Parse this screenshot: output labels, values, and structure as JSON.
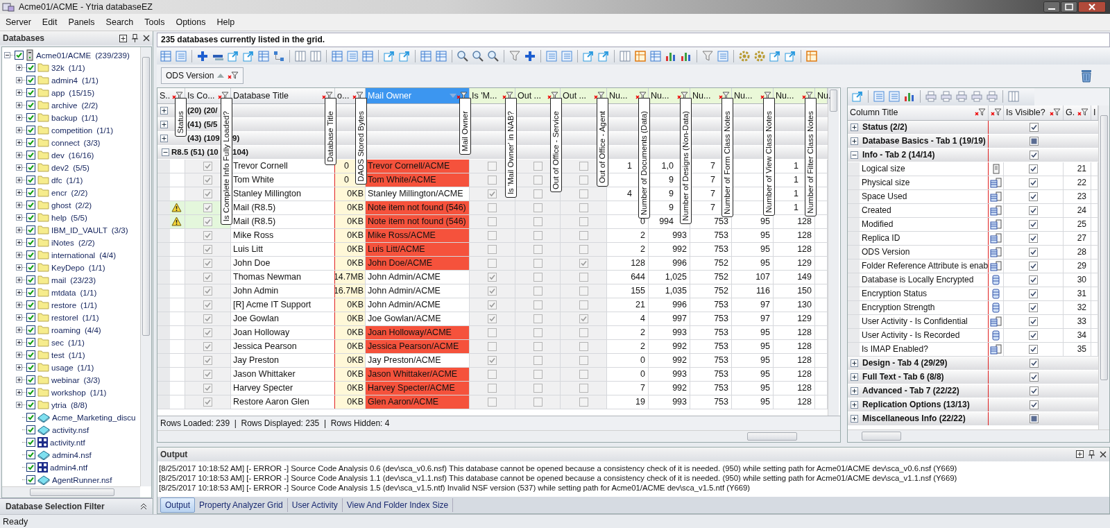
{
  "window": {
    "title": "Acme01/ACME - Ytria databaseEZ"
  },
  "menu": [
    "Server",
    "Edit",
    "Panels",
    "Search",
    "Tools",
    "Options",
    "Help"
  ],
  "databases_panel": {
    "title": "Databases",
    "tree": [
      {
        "kind": "server",
        "name": "Acme01/ACME",
        "count": "(239/239)",
        "checked": true,
        "expanded": true,
        "children": [
          {
            "kind": "folder",
            "name": "32k",
            "count": "(1/1)",
            "checked": true,
            "expanded": false
          },
          {
            "kind": "folder",
            "name": "admin4",
            "count": "(1/1)",
            "checked": true,
            "expanded": false
          },
          {
            "kind": "folder",
            "name": "app",
            "count": "(15/15)",
            "checked": true,
            "expanded": false
          },
          {
            "kind": "folder",
            "name": "archive",
            "count": "(2/2)",
            "checked": true,
            "expanded": false
          },
          {
            "kind": "folder",
            "name": "backup",
            "count": "(1/1)",
            "checked": true,
            "expanded": false
          },
          {
            "kind": "folder",
            "name": "competition",
            "count": "(1/1)",
            "checked": true,
            "expanded": false
          },
          {
            "kind": "folder",
            "name": "connect",
            "count": "(3/3)",
            "checked": true,
            "expanded": false
          },
          {
            "kind": "folder",
            "name": "dev",
            "count": "(16/16)",
            "checked": true,
            "expanded": false
          },
          {
            "kind": "folder",
            "name": "dev2",
            "count": "(5/5)",
            "checked": true,
            "expanded": false
          },
          {
            "kind": "folder",
            "name": "dfc",
            "count": "(1/1)",
            "checked": true,
            "expanded": false
          },
          {
            "kind": "folder",
            "name": "encr",
            "count": "(2/2)",
            "checked": true,
            "expanded": false
          },
          {
            "kind": "folder",
            "name": "ghost",
            "count": "(2/2)",
            "checked": true,
            "expanded": false
          },
          {
            "kind": "folder",
            "name": "help",
            "count": "(5/5)",
            "checked": true,
            "expanded": false
          },
          {
            "kind": "folder",
            "name": "IBM_ID_VAULT",
            "count": "(3/3)",
            "checked": true,
            "expanded": false
          },
          {
            "kind": "folder",
            "name": "iNotes",
            "count": "(2/2)",
            "checked": true,
            "expanded": false
          },
          {
            "kind": "folder",
            "name": "international",
            "count": "(4/4)",
            "checked": true,
            "expanded": false
          },
          {
            "kind": "folder",
            "name": "KeyDepo",
            "count": "(1/1)",
            "checked": true,
            "expanded": false
          },
          {
            "kind": "folder",
            "name": "mail",
            "count": "(23/23)",
            "checked": true,
            "expanded": false
          },
          {
            "kind": "folder",
            "name": "mtdata",
            "count": "(1/1)",
            "checked": true,
            "expanded": false
          },
          {
            "kind": "folder",
            "name": "restore",
            "count": "(1/1)",
            "checked": true,
            "expanded": false
          },
          {
            "kind": "folder",
            "name": "restorel",
            "count": "(1/1)",
            "checked": true,
            "expanded": false
          },
          {
            "kind": "folder",
            "name": "roaming",
            "count": "(4/4)",
            "checked": true,
            "expanded": false
          },
          {
            "kind": "folder",
            "name": "sec",
            "count": "(1/1)",
            "checked": true,
            "expanded": false
          },
          {
            "kind": "folder",
            "name": "test",
            "count": "(1/1)",
            "checked": true,
            "expanded": false
          },
          {
            "kind": "folder",
            "name": "usage",
            "count": "(1/1)",
            "checked": true,
            "expanded": false
          },
          {
            "kind": "folder",
            "name": "webinar",
            "count": "(3/3)",
            "checked": true,
            "expanded": false
          },
          {
            "kind": "folder",
            "name": "workshop",
            "count": "(1/1)",
            "checked": true,
            "expanded": false
          },
          {
            "kind": "folder",
            "name": "ytria",
            "count": "(8/8)",
            "checked": true,
            "expanded": false
          },
          {
            "kind": "nsf",
            "name": "Acme_Marketing_discu",
            "checked": true
          },
          {
            "kind": "nsf",
            "name": "activity.nsf",
            "checked": true
          },
          {
            "kind": "ntf",
            "name": "activity.ntf",
            "checked": true
          },
          {
            "kind": "nsf",
            "name": "admin4.nsf",
            "checked": true
          },
          {
            "kind": "ntf",
            "name": "admin4.ntf",
            "checked": true
          },
          {
            "kind": "nsf",
            "name": "AgentRunner.nsf",
            "checked": true
          }
        ]
      }
    ],
    "footer": "Database Selection Filter"
  },
  "info": "235 databases currently listed in the grid.",
  "group_by": [
    {
      "label": "ODS Version",
      "sorted_ascending": true
    }
  ],
  "grid": {
    "columns": [
      {
        "kind": "status",
        "title": "S..",
        "flag": "Status",
        "selected": false
      },
      {
        "kind": "complete",
        "title": "Is Co...",
        "flag": "Is Complete Info Fully Loaded?",
        "selected": false
      },
      {
        "kind": "title",
        "title": "Database Title",
        "flag": "Database Title",
        "selected": false
      },
      {
        "kind": "size",
        "title": "o...",
        "flag": "DAOS Stored Bytes",
        "selected": false
      },
      {
        "kind": "owner",
        "title": "Mail Owner",
        "flag": "Mail Owner",
        "selected": true,
        "sorted": true
      },
      {
        "kind": "check",
        "title": "Is 'M...",
        "flag": "Is 'Mail Owner' in NAB?",
        "selected": false,
        "color": "#eaf8d8"
      },
      {
        "kind": "check",
        "title": "Out ...",
        "flag": "Out of Office - Service",
        "selected": false,
        "color": "#eaf8d8"
      },
      {
        "kind": "check",
        "title": "Out ...",
        "flag": "Out of Office - Agent",
        "selected": false,
        "color": "#eaf8d8"
      },
      {
        "kind": "number",
        "title": "Nu...",
        "flag": "Number of Documents (Data)",
        "selected": false,
        "color": "#eaf8d8"
      },
      {
        "kind": "number",
        "title": "Nu...",
        "flag": "Number of Designs (Non-Data)",
        "selected": false,
        "color": "#eaf8d8"
      },
      {
        "kind": "number",
        "title": "Nu...",
        "flag": "Number of Form Class Notes",
        "selected": false,
        "color": "#eaf8d8"
      },
      {
        "kind": "number",
        "title": "Nu...",
        "flag": "Number of View Class Notes",
        "selected": false,
        "color": "#eaf8d8"
      },
      {
        "kind": "number",
        "title": "Nu...",
        "flag": "Number of Filter Class Notes",
        "selected": false,
        "color": "#eaf8d8"
      },
      {
        "kind": "number",
        "title": "Nu.",
        "selected": false,
        "color": "#eaf8d8"
      }
    ],
    "groups": [
      {
        "label": "(20) (20/",
        "expanded": false
      },
      {
        "label": "(41) (5/5",
        "expanded": false
      },
      {
        "label": "(43) (109",
        "tail": "9)",
        "expanded": false
      },
      {
        "label": "R8.5 (51) (10",
        "tail": "104)",
        "expanded": true,
        "rows": [
          {
            "warning": false,
            "complete": true,
            "title": "Trevor Cornell",
            "daos": "0",
            "owner": "Trevor Cornell/ACME",
            "owner_error": true,
            "in_nab": false,
            "ooo_service": false,
            "ooo_agent": false,
            "docs": "1",
            "designs": "1,0",
            "forms": "7",
            "filters": "1"
          },
          {
            "warning": false,
            "complete": true,
            "title": "Tom White",
            "daos": "0",
            "owner": "Tom White/ACME",
            "owner_error": true,
            "in_nab": false,
            "ooo_service": false,
            "ooo_agent": false,
            "designs": "9",
            "forms": "7",
            "filters": "1"
          },
          {
            "warning": false,
            "complete": true,
            "title": "Stanley Millington",
            "daos": "0KB",
            "owner": "Stanley Millington/ACME",
            "owner_error": false,
            "in_nab": true,
            "ooo_service": false,
            "ooo_agent": false,
            "docs": "4",
            "designs": "9",
            "forms": "7",
            "filters": "1"
          },
          {
            "warning": true,
            "complete": true,
            "title": "Mail (R8.5)",
            "daos": "0KB",
            "owner": "Note item not found (546)",
            "owner_error": true,
            "in_nab": false,
            "ooo_service": false,
            "ooo_agent": false,
            "designs": "9",
            "forms": "7",
            "filters": "1"
          },
          {
            "warning": true,
            "complete": true,
            "title": "Mail (R8.5)",
            "daos": "0KB",
            "owner": "Note item not found (546)",
            "owner_error": true,
            "in_nab": false,
            "ooo_service": false,
            "ooo_agent": false,
            "docs": "0",
            "designs": "994",
            "forms": "753",
            "views": "95",
            "filters": "128"
          },
          {
            "warning": false,
            "complete": true,
            "title": "Mike Ross",
            "daos": "0KB",
            "owner": "Mike Ross/ACME",
            "owner_error": true,
            "in_nab": false,
            "ooo_service": false,
            "ooo_agent": false,
            "docs": "2",
            "designs": "993",
            "forms": "753",
            "views": "95",
            "filters": "128"
          },
          {
            "warning": false,
            "complete": true,
            "title": "Luis Litt",
            "daos": "0KB",
            "owner": "Luis Litt/ACME",
            "owner_error": true,
            "in_nab": false,
            "ooo_service": false,
            "ooo_agent": false,
            "docs": "2",
            "designs": "992",
            "forms": "753",
            "views": "95",
            "filters": "128"
          },
          {
            "warning": false,
            "complete": true,
            "title": "John Doe",
            "daos": "0KB",
            "owner": "John Doe/ACME",
            "owner_error": true,
            "in_nab": false,
            "ooo_service": false,
            "ooo_agent": true,
            "docs": "128",
            "designs": "996",
            "forms": "752",
            "views": "95",
            "filters": "129"
          },
          {
            "warning": false,
            "complete": true,
            "title": "Thomas Newman",
            "daos": "14.7MB",
            "owner": "John Admin/ACME",
            "owner_error": false,
            "in_nab": true,
            "ooo_service": false,
            "ooo_agent": false,
            "docs": "644",
            "designs": "1,025",
            "forms": "752",
            "views": "107",
            "filters": "149"
          },
          {
            "warning": false,
            "complete": true,
            "title": "John Admin",
            "daos": "16.7MB",
            "owner": "John Admin/ACME",
            "owner_error": false,
            "in_nab": true,
            "ooo_service": false,
            "ooo_agent": false,
            "docs": "155",
            "designs": "1,035",
            "forms": "752",
            "views": "116",
            "filters": "150"
          },
          {
            "warning": false,
            "complete": true,
            "title": "[R] Acme IT Support",
            "daos": "0KB",
            "owner": "John Admin/ACME",
            "owner_error": false,
            "in_nab": true,
            "ooo_service": false,
            "ooo_agent": false,
            "docs": "21",
            "designs": "996",
            "forms": "753",
            "views": "97",
            "filters": "130"
          },
          {
            "warning": false,
            "complete": true,
            "title": "Joe Gowlan",
            "daos": "0KB",
            "owner": "Joe Gowlan/ACME",
            "owner_error": false,
            "in_nab": true,
            "ooo_service": false,
            "ooo_agent": true,
            "docs": "4",
            "designs": "997",
            "forms": "753",
            "views": "97",
            "filters": "129"
          },
          {
            "warning": false,
            "complete": true,
            "title": "Joan Holloway",
            "daos": "0KB",
            "owner": "Joan Holloway/ACME",
            "owner_error": true,
            "in_nab": false,
            "ooo_service": false,
            "ooo_agent": false,
            "docs": "2",
            "designs": "993",
            "forms": "753",
            "views": "95",
            "filters": "128"
          },
          {
            "warning": false,
            "complete": true,
            "title": "Jessica Pearson",
            "daos": "0KB",
            "owner": "Jessica Pearson/ACME",
            "owner_error": true,
            "in_nab": false,
            "ooo_service": false,
            "ooo_agent": false,
            "docs": "2",
            "designs": "992",
            "forms": "753",
            "views": "95",
            "filters": "128"
          },
          {
            "warning": false,
            "complete": true,
            "title": "Jay Preston",
            "daos": "0KB",
            "owner": "Jay Preston/ACME",
            "owner_error": false,
            "in_nab": true,
            "ooo_service": false,
            "ooo_agent": false,
            "docs": "0",
            "designs": "992",
            "forms": "753",
            "views": "95",
            "filters": "128"
          },
          {
            "warning": false,
            "complete": true,
            "title": "Jason Whittaker",
            "daos": "0KB",
            "owner": "Jason Whittaker/ACME",
            "owner_error": true,
            "in_nab": false,
            "ooo_service": false,
            "ooo_agent": false,
            "docs": "0",
            "designs": "993",
            "forms": "753",
            "views": "95",
            "filters": "128"
          },
          {
            "warning": false,
            "complete": true,
            "title": "Harvey Specter",
            "daos": "0KB",
            "owner": "Harvey Specter/ACME",
            "owner_error": true,
            "in_nab": false,
            "ooo_service": false,
            "ooo_agent": false,
            "docs": "7",
            "designs": "992",
            "forms": "753",
            "views": "95",
            "filters": "128"
          },
          {
            "warning": false,
            "complete": true,
            "title": "Restore Aaron Glen",
            "daos": "0KB",
            "owner": "Glen Aaron/ACME",
            "owner_error": true,
            "in_nab": false,
            "ooo_service": false,
            "ooo_agent": false,
            "docs": "19",
            "designs": "993",
            "forms": "753",
            "views": "95",
            "filters": "128"
          }
        ]
      }
    ],
    "footer": "Rows Loaded: 239  |  Rows Displayed: 235  |  Rows Hidden: 4"
  },
  "column_panel": {
    "headers": [
      "Column Title",
      "Is Visible?",
      "G.",
      "I"
    ],
    "groups": [
      {
        "label": "Status (2/2)",
        "visible": true,
        "mixed": false,
        "expanded": false
      },
      {
        "label": "Database Basics - Tab 1 (19/19)",
        "visible": true,
        "mixed": true,
        "expanded": false
      },
      {
        "label": "Info - Tab 2 (14/14)",
        "visible": true,
        "mixed": false,
        "expanded": true,
        "children": [
          {
            "label": "Logical size",
            "kind": "single",
            "visible": true,
            "order": "21"
          },
          {
            "label": "Physical size",
            "kind": "multi",
            "visible": true,
            "order": "22"
          },
          {
            "label": "Space Used",
            "kind": "multi",
            "visible": true,
            "order": "23"
          },
          {
            "label": "Created",
            "kind": "multi",
            "visible": true,
            "order": "24"
          },
          {
            "label": "Modified",
            "kind": "multi",
            "visible": true,
            "order": "25"
          },
          {
            "label": "Replica ID",
            "kind": "multi",
            "visible": true,
            "order": "27"
          },
          {
            "label": "ODS Version",
            "kind": "multi",
            "visible": true,
            "order": "28"
          },
          {
            "label": "Folder Reference Attribute is enab",
            "kind": "multi",
            "visible": true,
            "order": "29"
          },
          {
            "label": "Database is Locally Encrypted",
            "kind": "stack",
            "visible": true,
            "order": "30"
          },
          {
            "label": "Encryption Status",
            "kind": "stack",
            "visible": true,
            "order": "31"
          },
          {
            "label": "Encryption Strength",
            "kind": "stack",
            "visible": true,
            "order": "32"
          },
          {
            "label": "User Activity - Is Confidential",
            "kind": "multi",
            "visible": true,
            "order": "33"
          },
          {
            "label": "User Activity - Is Recorded",
            "kind": "stack",
            "visible": true,
            "order": "34"
          },
          {
            "label": "Is IMAP Enabled?",
            "kind": "multi",
            "visible": true,
            "order": "35"
          }
        ]
      },
      {
        "label": "Design - Tab 4 (29/29)",
        "visible": true,
        "mixed": false,
        "expanded": false
      },
      {
        "label": "Full Text - Tab 6 (8/8)",
        "visible": true,
        "mixed": false,
        "expanded": false
      },
      {
        "label": "Advanced - Tab 7 (22/22)",
        "visible": true,
        "mixed": false,
        "expanded": false
      },
      {
        "label": "Replication Options (13/13)",
        "visible": true,
        "mixed": false,
        "expanded": false
      },
      {
        "label": "Miscellaneous Info (22/22)",
        "visible": true,
        "mixed": true,
        "expanded": false
      }
    ]
  },
  "output": {
    "title": "Output",
    "lines": [
      "[8/25/2017 10:18:52 AM] [- ERROR -] Source Code Analysis 0.6 (dev\\sca_v0.6.nsf) This database cannot be opened because a consistency check of it is needed. (950) while setting path for Acme01/ACME dev\\sca_v0.6.nsf (Y669)",
      "[8/25/2017 10:18:53 AM] [- ERROR -] Source Code Analysis 1.1 (dev\\sca_v1.1.nsf) This database cannot be opened because a consistency check of it is needed. (950) while setting path for Acme01/ACME dev\\sca_v1.1.nsf (Y669)",
      "[8/25/2017 10:18:53 AM] [- ERROR -] Source Code Analysis 1.5 (dev\\sca_v1.5.ntf) Invalid NSF version (537) while setting path for Acme01/ACME dev\\sca_v1.5.ntf (Y669)"
    ],
    "tabs": [
      {
        "label": "Output",
        "selected": true
      },
      {
        "label": "Property Analyzer Grid",
        "selected": false
      },
      {
        "label": "User Activity",
        "selected": false
      },
      {
        "label": "View And Folder Index Size",
        "selected": false
      }
    ]
  },
  "status_bar": "Ready"
}
